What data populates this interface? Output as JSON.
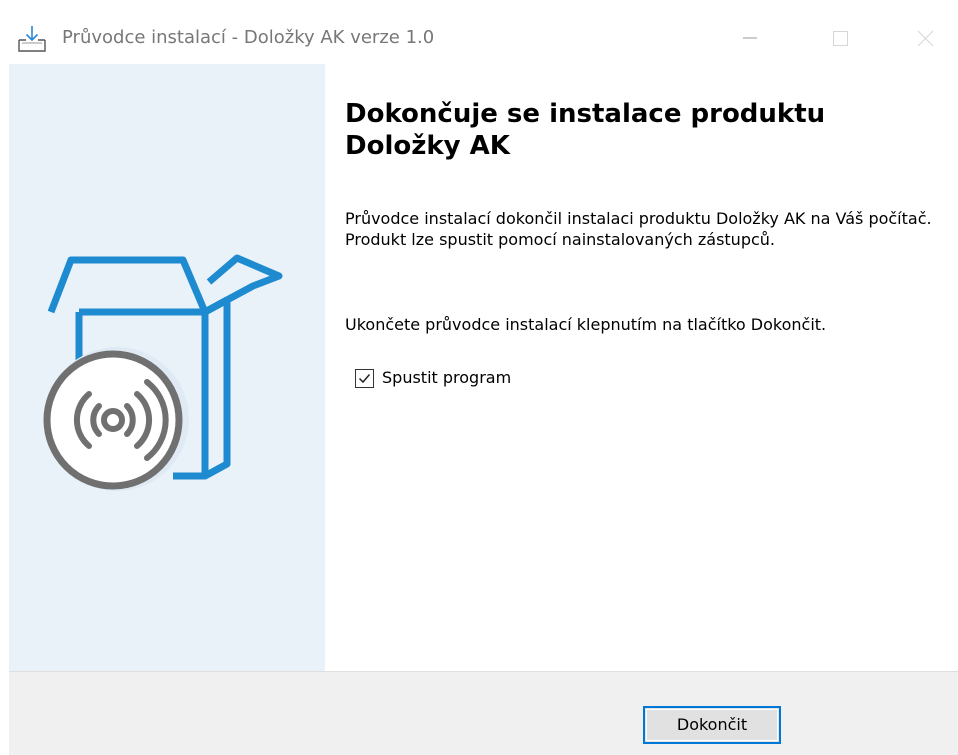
{
  "window": {
    "title": "Průvodce instalací - Doložky AK verze 1.0",
    "controls": [
      "minimize-icon",
      "maximize-icon",
      "close-icon"
    ]
  },
  "banner": {
    "art": "box-with-disc-icon"
  },
  "content": {
    "heading": "Dokončuje se instalace produktu Doložky AK",
    "paragraph1": "Průvodce instalací dokončil instalaci produktu Doložky AK na Váš počítač. Produkt lze spustit pomocí nainstalovaných zástupců.",
    "paragraph2": "Ukončete průvodce instalací klepnutím na tlačítko Dokončit.",
    "checkbox": {
      "label": "Spustit program",
      "checked": true
    }
  },
  "footer": {
    "finish_label": "Dokončit"
  },
  "colors": {
    "accent": "#0078d7",
    "banner_bg": "#e9f2f9",
    "box_blue": "#1e8bd1",
    "disc_gray": "#707070",
    "footer_bg": "#f0f0f0"
  }
}
